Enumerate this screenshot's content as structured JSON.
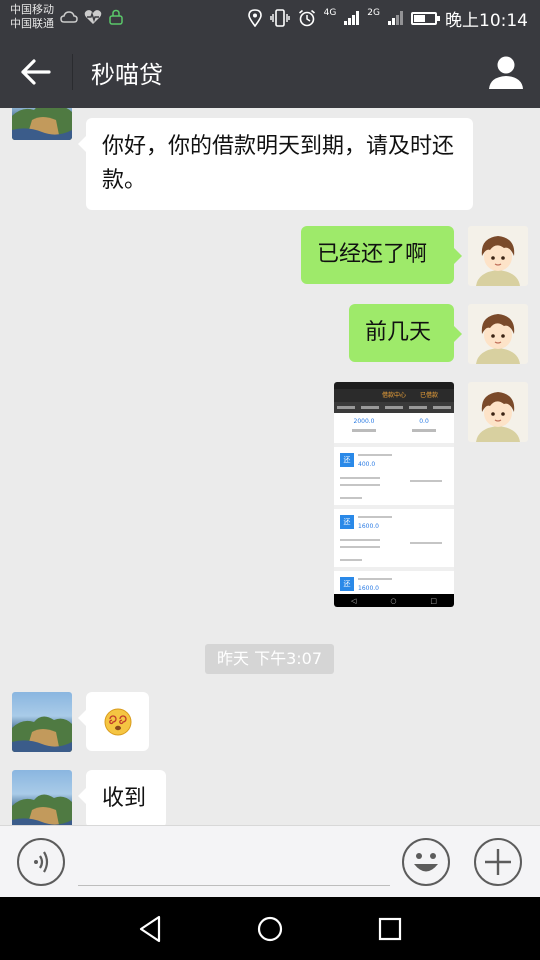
{
  "status_bar": {
    "carrier_1": "中国移动",
    "carrier_2": "中国联通",
    "net_1": "4G",
    "net_2": "2G",
    "time": "晚上10:14"
  },
  "header": {
    "title": "秒喵贷",
    "back_icon": "arrow-left-icon",
    "profile_icon": "person-icon"
  },
  "messages": [
    {
      "side": "left",
      "type": "text",
      "text": "你好，你的借款明天到期，请及时还款。"
    },
    {
      "side": "right",
      "type": "text",
      "text": "已经还了啊"
    },
    {
      "side": "right",
      "type": "text",
      "text": "前几天"
    },
    {
      "side": "right",
      "type": "image",
      "image": {
        "header_title": "借款中心",
        "header_tab": "已借款",
        "summary_1": "2000.0",
        "summary_2": "0.0",
        "card_badge": "还",
        "card_amounts": [
          "400.0",
          "1600.0",
          "1600.0"
        ]
      }
    },
    {
      "type": "time",
      "text": "昨天 下午3:07"
    },
    {
      "side": "left",
      "type": "emoji",
      "emoji": "dizzy-face-icon"
    },
    {
      "side": "left",
      "type": "text",
      "text": "收到"
    }
  ],
  "input_bar": {
    "voice_icon": "voice-icon",
    "emoji_icon": "smiley-icon",
    "plus_icon": "plus-icon",
    "value": ""
  },
  "nav_bar": {
    "back_icon": "triangle-back-icon",
    "home_icon": "circle-home-icon",
    "recent_icon": "square-recent-icon"
  },
  "colors": {
    "header_bg": "#393a3f",
    "chat_bg": "#ebebeb",
    "sent_bubble": "#9eea6a",
    "received_bubble": "#ffffff"
  }
}
